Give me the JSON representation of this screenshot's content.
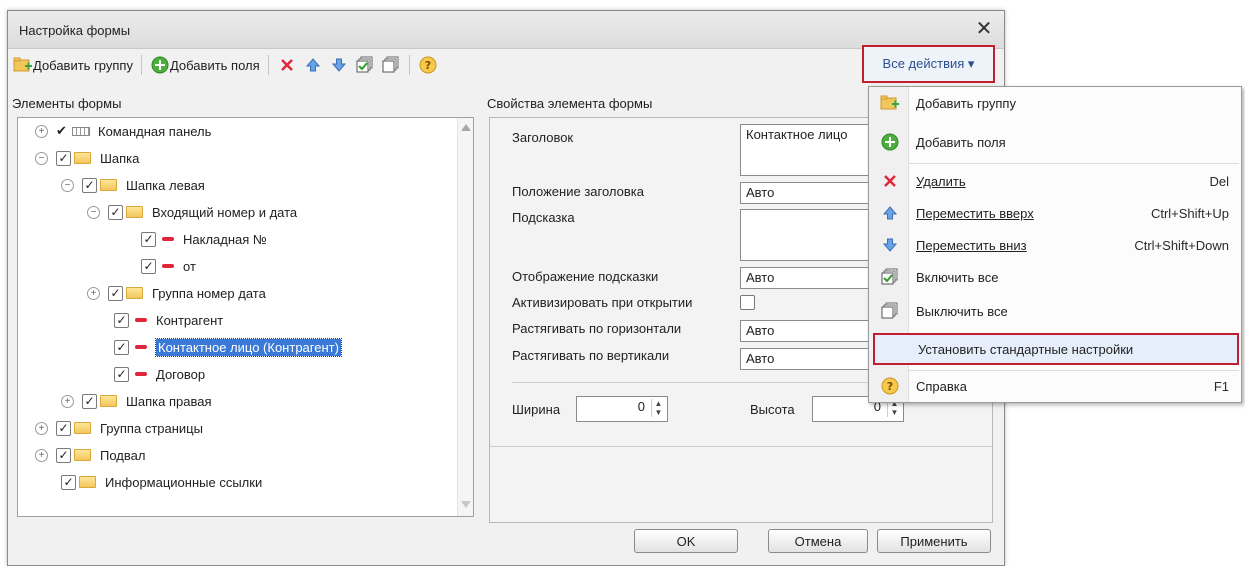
{
  "window": {
    "title": "Настройка формы",
    "close": "✕"
  },
  "toolbar": {
    "add_group": "Добавить группу",
    "add_fields": "Добавить поля",
    "all_actions": "Все действия ▾"
  },
  "left_panel": {
    "title": "Элементы формы"
  },
  "tree": {
    "items": [
      {
        "label": "Командная панель",
        "selected": false
      },
      {
        "label": "Шапка",
        "selected": false
      },
      {
        "label": "Шапка левая",
        "selected": false
      },
      {
        "label": "Входящий номер и дата",
        "selected": false
      },
      {
        "label": "Накладная №",
        "selected": false
      },
      {
        "label": "от",
        "selected": false
      },
      {
        "label": "Группа номер дата",
        "selected": false
      },
      {
        "label": "Контрагент",
        "selected": false
      },
      {
        "label": "Контактное лицо (Контрагент)",
        "selected": true
      },
      {
        "label": "Договор",
        "selected": false
      },
      {
        "label": "Шапка правая",
        "selected": false
      },
      {
        "label": "Группа страницы",
        "selected": false
      },
      {
        "label": "Подвал",
        "selected": false
      },
      {
        "label": "Информационные ссылки",
        "selected": false
      }
    ]
  },
  "props": {
    "title": "Свойства элемента формы",
    "header_label": "Заголовок",
    "header_value": "Контактное лицо",
    "header_pos_label": "Положение заголовка",
    "header_pos_value": "Авто",
    "hint_label": "Подсказка",
    "hint_value": "",
    "hint_display_label": "Отображение подсказки",
    "hint_display_value": "Авто",
    "activate_label": "Активизировать при открытии",
    "stretch_h_label": "Растягивать по горизонтали",
    "stretch_h_value": "Авто",
    "stretch_v_label": "Растягивать по вертикали",
    "stretch_v_value": "Авто",
    "width_label": "Ширина",
    "width_value": "0",
    "height_label": "Высота",
    "height_value": "0"
  },
  "buttons": {
    "ok": "OK",
    "cancel": "Отмена",
    "apply": "Применить"
  },
  "menu": {
    "add_group": "Добавить группу",
    "add_fields": "Добавить поля",
    "delete": "Удалить",
    "delete_shortcut": "Del",
    "move_up": "Переместить вверх",
    "move_up_shortcut": "Ctrl+Shift+Up",
    "move_down": "Переместить вниз",
    "move_down_shortcut": "Ctrl+Shift+Down",
    "enable_all": "Включить все",
    "disable_all": "Выключить все",
    "set_default": "Установить стандартные настройки",
    "help": "Справка",
    "help_shortcut": "F1"
  },
  "colors": {
    "highlight_border": "#c0202e",
    "selection": "#3a79d6",
    "delete_icon": "#e0263a",
    "add_icon": "#4cae3c",
    "arrow_icon": "#4a88d8"
  }
}
